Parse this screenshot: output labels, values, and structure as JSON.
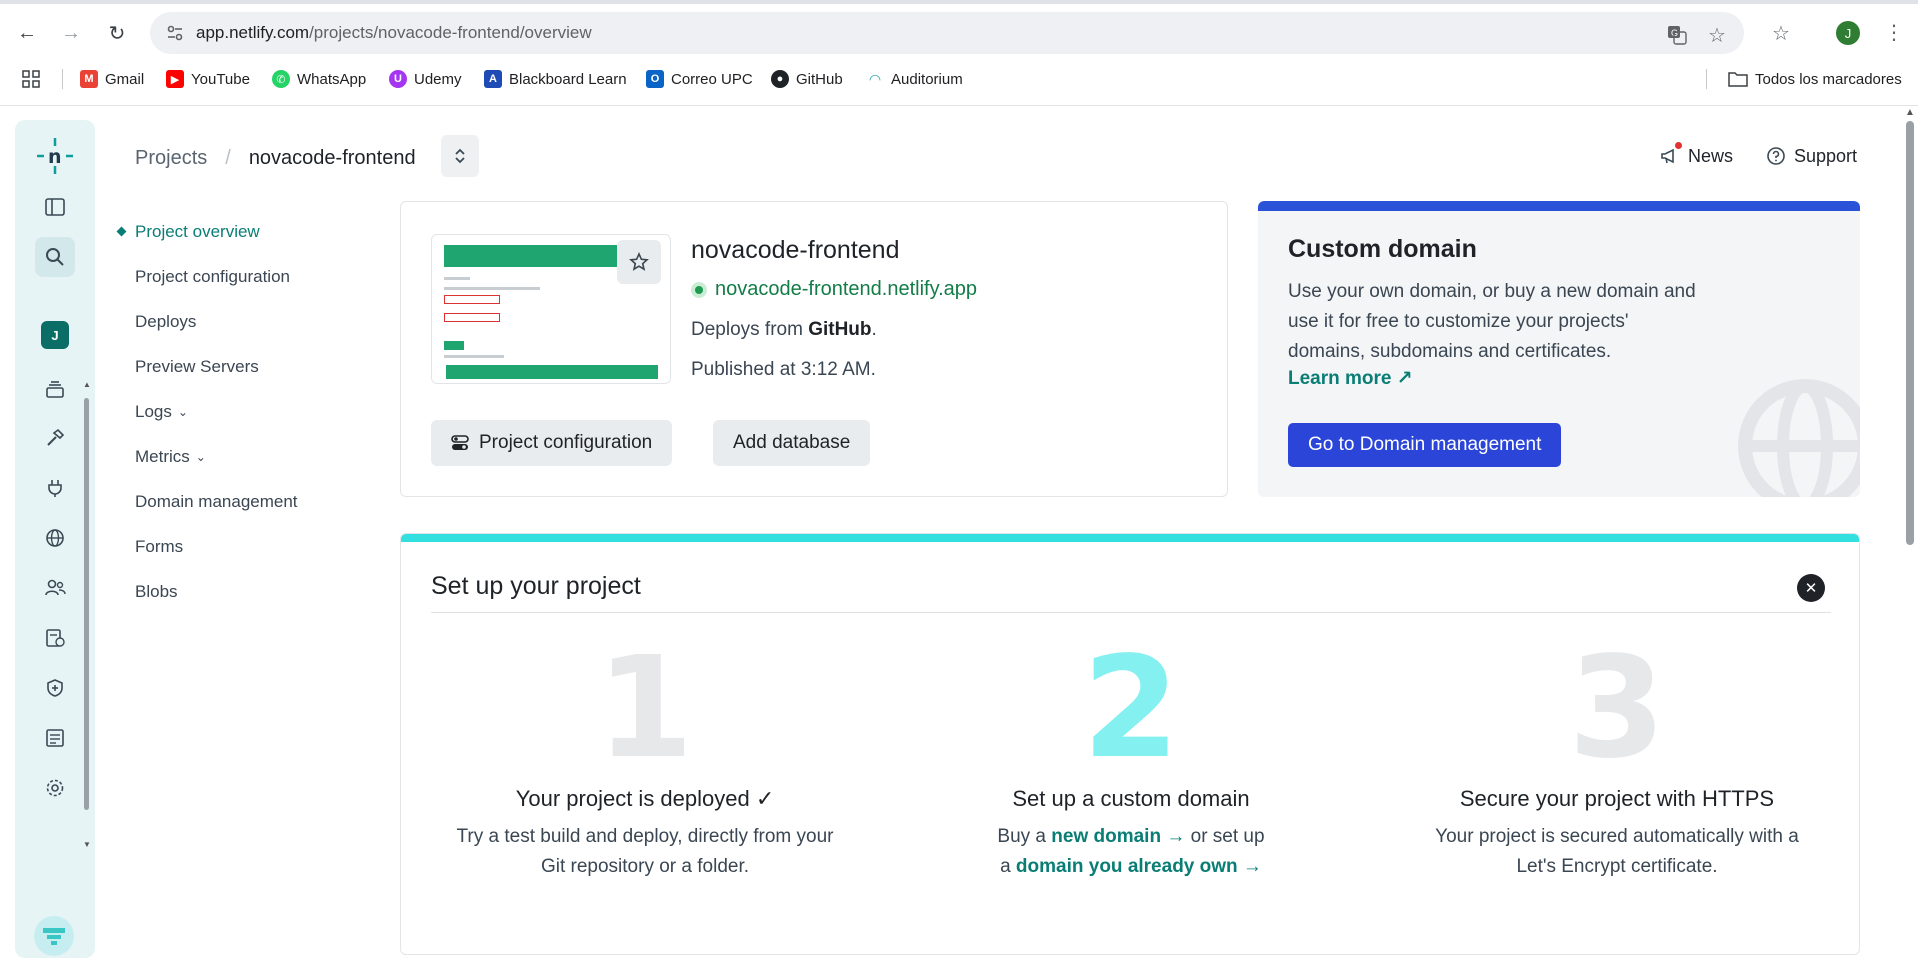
{
  "browser": {
    "url_host": "app.netlify.com",
    "url_path": "/projects/novacode-frontend/overview",
    "profile_initial": "J",
    "bookmarks": [
      {
        "label": "Gmail",
        "icon": "gmail-icon",
        "color": "#ea4335"
      },
      {
        "label": "YouTube",
        "icon": "youtube-icon",
        "color": "#ff0000"
      },
      {
        "label": "WhatsApp",
        "icon": "whatsapp-icon",
        "color": "#25d366"
      },
      {
        "label": "Udemy",
        "icon": "udemy-icon",
        "color": "#a435f0"
      },
      {
        "label": "Blackboard Learn",
        "icon": "blackboard-icon",
        "color": "#1e4bb5"
      },
      {
        "label": "Correo UPC",
        "icon": "outlook-icon",
        "color": "#0a64c8"
      },
      {
        "label": "GitHub",
        "icon": "github-icon",
        "color": "#1f2328"
      },
      {
        "label": "Auditorium",
        "icon": "auditorium-icon",
        "color": "#2aa6a0"
      }
    ],
    "all_bookmarks": "Todos los marcadores"
  },
  "app": {
    "avatar_initial": "J",
    "breadcrumb": {
      "root": "Projects",
      "separator": "/",
      "current": "novacode-frontend"
    },
    "top_links": {
      "news": "News",
      "support": "Support"
    },
    "sidenav": [
      {
        "label": "Project overview",
        "active": true
      },
      {
        "label": "Project configuration"
      },
      {
        "label": "Deploys"
      },
      {
        "label": "Preview Servers"
      },
      {
        "label": "Logs",
        "chevron": "⌄"
      },
      {
        "label": "Metrics",
        "chevron": "⌄"
      },
      {
        "label": "Domain management"
      },
      {
        "label": "Forms"
      },
      {
        "label": "Blobs"
      }
    ],
    "overview": {
      "title": "novacode-frontend",
      "url": "novacode-frontend.netlify.app",
      "deploys_prefix": "Deploys from ",
      "deploys_source": "GitHub",
      "deploys_suffix": ".",
      "published": "Published at 3:12 AM.",
      "btn_config": "Project configuration",
      "btn_database": "Add database"
    },
    "domain": {
      "title": "Custom domain",
      "desc": "Use your own domain, or buy a new domain and use it for free to customize your projects' domains, subdomains and certificates.",
      "learn_more": "Learn more ↗",
      "button": "Go to Domain management",
      "accent": "#2a45d8"
    },
    "setup": {
      "title": "Set up your project",
      "close": "✕",
      "steps": [
        {
          "num": "1",
          "title": "Your project is deployed ✓",
          "desc": "Try a test build and deploy, directly from your Git repository or a folder."
        },
        {
          "num": "2",
          "title": "Set up a custom domain",
          "desc_prefix": "Buy a ",
          "link1": "new domain →",
          "desc_mid": "  or set up",
          "desc_a": "a ",
          "link2": "domain you already own →"
        },
        {
          "num": "3",
          "title": "Secure your project with HTTPS",
          "desc": "Your project is secured automatically with a Let's Encrypt certificate."
        }
      ]
    }
  }
}
